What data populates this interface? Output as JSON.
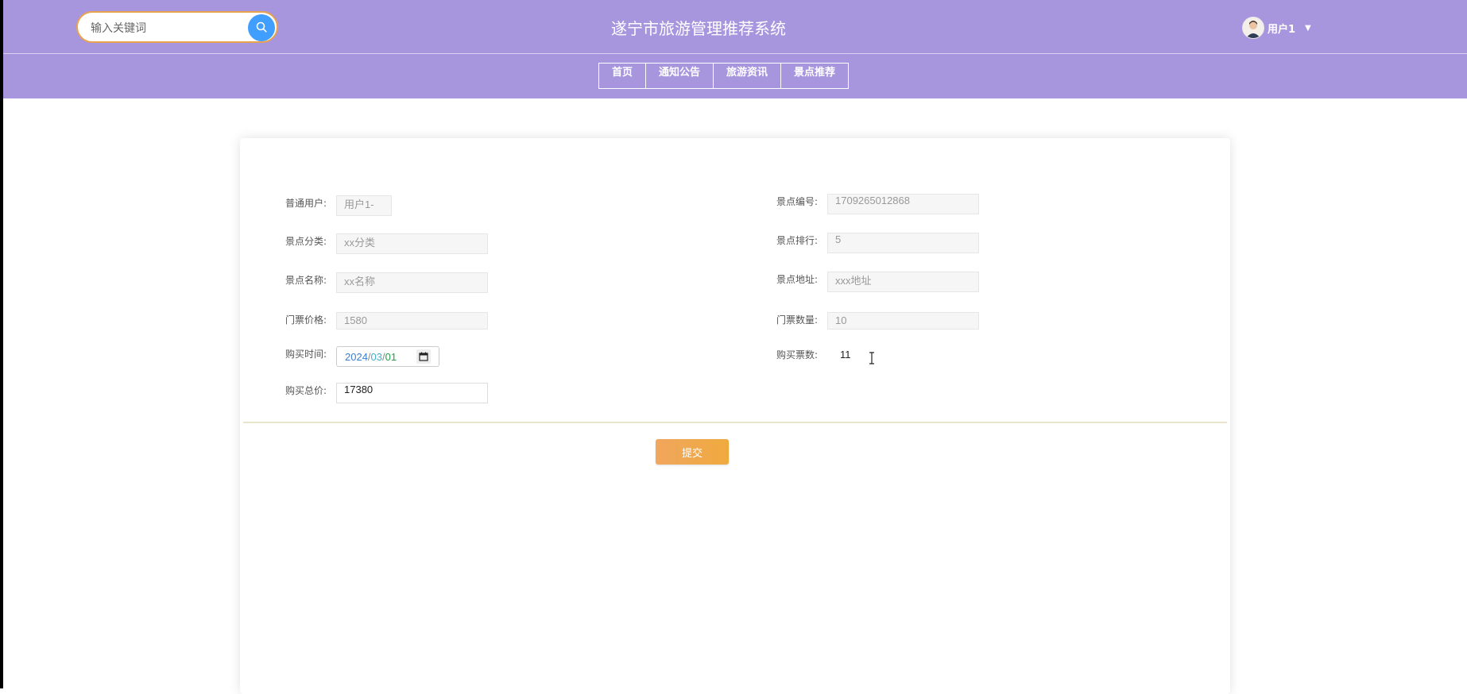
{
  "header": {
    "title": "遂宁市旅游管理推荐系统",
    "search_placeholder": "输入关键词",
    "user_name": "用户1",
    "colors": {
      "bar": "#a795de",
      "search_button": "#409eff",
      "search_border": "#e7a34d"
    }
  },
  "nav": {
    "items": [
      {
        "label": "首页"
      },
      {
        "label": "通知公告"
      },
      {
        "label": "旅游资讯"
      },
      {
        "label": "景点推荐"
      }
    ]
  },
  "form": {
    "user": {
      "label": "普通用户:",
      "value": "用户1-"
    },
    "spot_no": {
      "label": "景点编号:",
      "value": "1709265012868"
    },
    "category": {
      "label": "景点分类:",
      "value": "xx分类"
    },
    "rank": {
      "label": "景点排行:",
      "value": "5"
    },
    "name": {
      "label": "景点名称:",
      "value": "xx名称"
    },
    "address": {
      "label": "景点地址:",
      "value": "xxx地址"
    },
    "price": {
      "label": "门票价格:",
      "value": "1580"
    },
    "stock": {
      "label": "门票数量:",
      "value": "10"
    },
    "purchase_time": {
      "label": "购买时间:",
      "year": "2024",
      "month": "03",
      "day": "01",
      "sep": "/"
    },
    "purchase_qty": {
      "label": "购买票数:",
      "value": "11"
    },
    "total": {
      "label": "购买总价:",
      "value": "17380"
    }
  },
  "actions": {
    "submit_label": "提交",
    "submit_color": "#f0a84d"
  }
}
